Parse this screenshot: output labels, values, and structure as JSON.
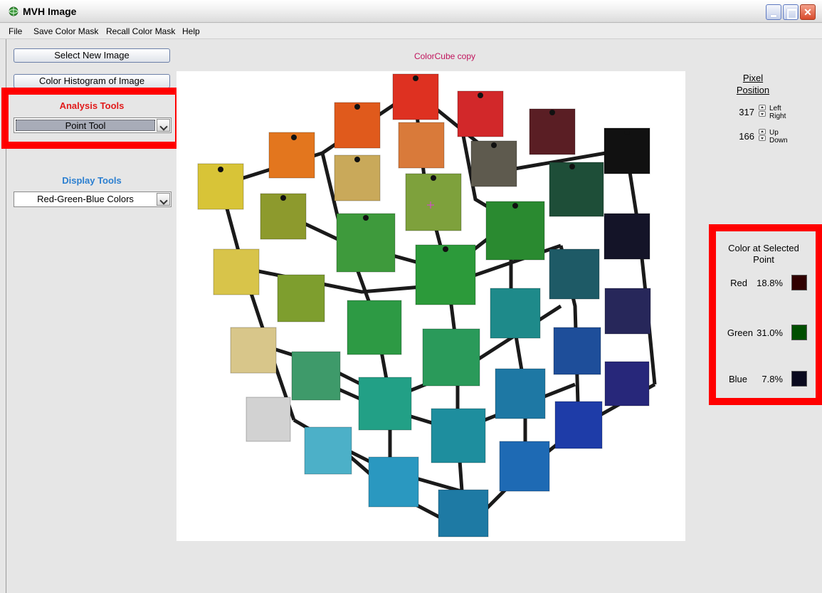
{
  "window": {
    "title": "MVH Image",
    "app_icon": "globe-icon",
    "controls": [
      "minimize-icon",
      "maximize-icon",
      "close-icon"
    ]
  },
  "menu": {
    "items": [
      "File",
      "Save Color Mask",
      "Recall Color Mask",
      "Help"
    ]
  },
  "left_panel": {
    "select_button": "Select New Image",
    "histogram_button": "Color Histogram of Image",
    "analysis_label": "Analysis Tools",
    "analysis_value": "Point Tool",
    "display_label": "Display Tools",
    "display_value": "Red-Green-Blue Colors"
  },
  "image": {
    "title": "ColorCube copy",
    "cursor_marker": "crosshair-icon"
  },
  "pixel_position": {
    "heading": "Pixel Position",
    "x_value": "317",
    "x_left": "Left",
    "x_right": "Right",
    "y_value": "166",
    "y_up": "Up",
    "y_down": "Down"
  },
  "color_at_point": {
    "heading": "Color at Selected Point",
    "red_label": "Red",
    "red_value": "18.8%",
    "green_label": "Green",
    "green_value": "31.0%",
    "blue_label": "Blue",
    "blue_value": "7.8%",
    "red_swatch": "#300000",
    "green_swatch": "#004f00",
    "blue_swatch": "#0a0a1e"
  },
  "colors": {
    "highlight": "#ff0000",
    "analysis_label": "#e11a1a",
    "display_label": "#2b7fd0",
    "image_title": "#c0145c"
  }
}
